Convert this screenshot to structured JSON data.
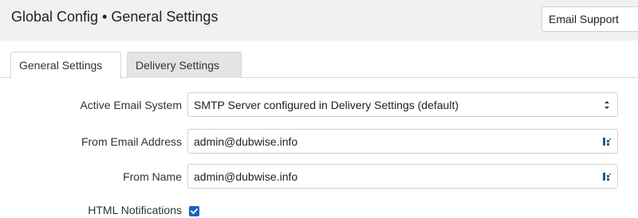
{
  "header": {
    "title": "Global Config • General Settings",
    "action_button": "Email Support"
  },
  "tabs": [
    {
      "label": "General Settings",
      "active": true
    },
    {
      "label": "Delivery Settings",
      "active": false
    }
  ],
  "form": {
    "active_email_system": {
      "label": "Active Email System",
      "value": "SMTP Server configured in Delivery Settings (default)"
    },
    "from_email": {
      "label": "From Email Address",
      "value": "admin@dubwise.info",
      "icon": "password-manager-icon"
    },
    "from_name": {
      "label": "From Name",
      "value": "admin@dubwise.info",
      "icon": "password-manager-icon"
    },
    "html_notifications": {
      "label": "HTML Notifications",
      "checked": true
    }
  },
  "colors": {
    "header_bg": "#f1f1f1",
    "checkbox_accent": "#1565c0",
    "field_icon": "#1a5c8c"
  }
}
